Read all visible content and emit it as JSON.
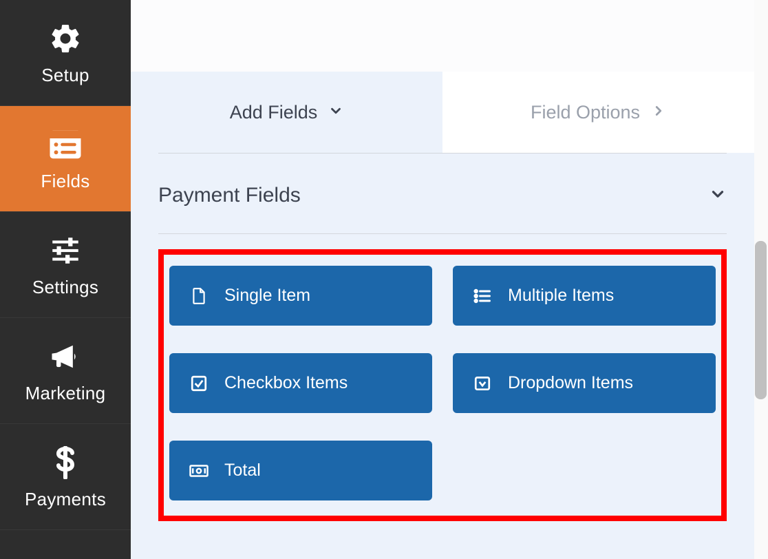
{
  "sidebar": {
    "items": [
      {
        "label": "Setup",
        "icon": "gear"
      },
      {
        "label": "Fields",
        "icon": "form"
      },
      {
        "label": "Settings",
        "icon": "sliders"
      },
      {
        "label": "Marketing",
        "icon": "megaphone"
      },
      {
        "label": "Payments",
        "icon": "dollar"
      }
    ]
  },
  "tabs": {
    "add": "Add Fields",
    "options": "Field Options"
  },
  "panel": {
    "title": "Payment Fields"
  },
  "fields": {
    "single": "Single Item",
    "multiple": "Multiple Items",
    "checkbox": "Checkbox Items",
    "dropdown": "Dropdown Items",
    "total": "Total"
  },
  "colors": {
    "accent": "#e27730",
    "button": "#1c67aa",
    "highlight": "#ff0000"
  }
}
